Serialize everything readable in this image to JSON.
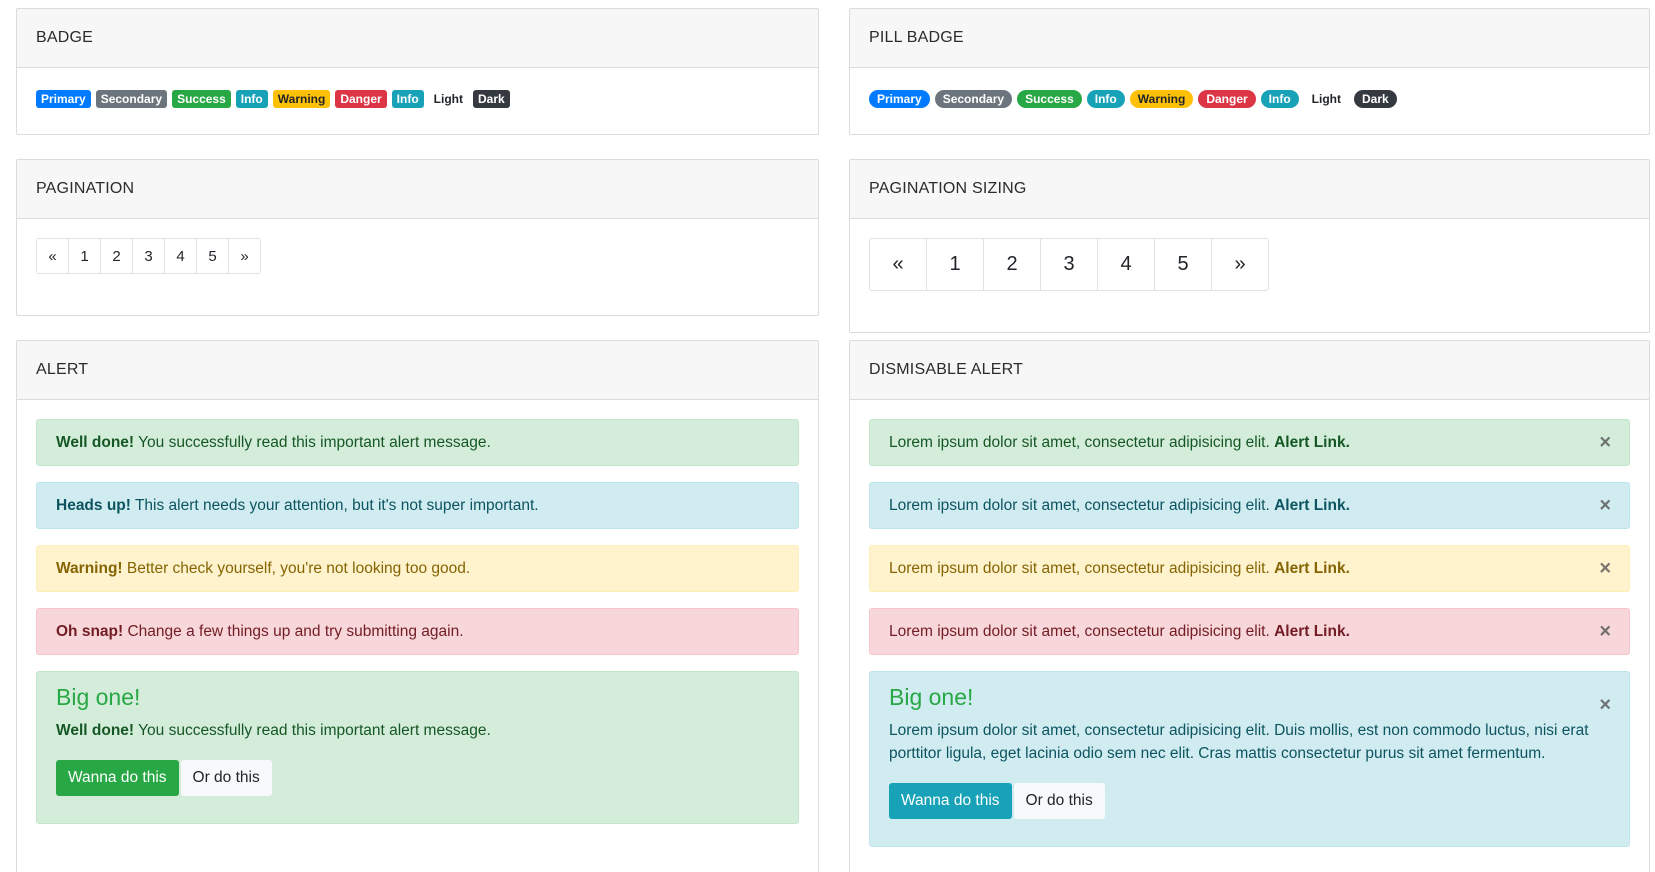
{
  "badge_card": {
    "title": "BADGE",
    "badges": [
      "Primary",
      "Secondary",
      "Success",
      "Info",
      "Warning",
      "Danger",
      "Info",
      "Light",
      "Dark"
    ]
  },
  "pill_card": {
    "title": "PILL BADGE",
    "badges": [
      "Primary",
      "Secondary",
      "Success",
      "Info",
      "Warning",
      "Danger",
      "Info",
      "Light",
      "Dark"
    ]
  },
  "pagination_card": {
    "title": "PAGINATION",
    "pages": [
      "«",
      "1",
      "2",
      "3",
      "4",
      "5",
      "»"
    ]
  },
  "pagination_sizing_card": {
    "title": "PAGINATION SIZING",
    "pages": [
      "«",
      "1",
      "2",
      "3",
      "4",
      "5",
      "»"
    ]
  },
  "alert_card": {
    "title": "ALERT",
    "alerts": [
      {
        "strong": "Well done!",
        "text": " You successfully read this important alert message."
      },
      {
        "strong": "Heads up!",
        "text": " This alert needs your attention, but it's not super important."
      },
      {
        "strong": "Warning!",
        "text": " Better check yourself, you're not looking too good."
      },
      {
        "strong": "Oh snap!",
        "text": " Change a few things up and try submitting again."
      }
    ],
    "big": {
      "title": "Big one!",
      "strong": "Well done!",
      "text": " You successfully read this important alert message.",
      "primary_button": "Wanna do this",
      "secondary_button": "Or do this"
    }
  },
  "dismissable_card": {
    "title": "DISMISABLE ALERT",
    "alerts": [
      {
        "text": "Lorem ipsum dolor sit amet, consectetur adipisicing elit. ",
        "link": "Alert Link."
      },
      {
        "text": "Lorem ipsum dolor sit amet, consectetur adipisicing elit. ",
        "link": "Alert Link."
      },
      {
        "text": "Lorem ipsum dolor sit amet, consectetur adipisicing elit. ",
        "link": "Alert Link."
      },
      {
        "text": "Lorem ipsum dolor sit amet, consectetur adipisicing elit. ",
        "link": "Alert Link."
      }
    ],
    "close_symbol": "×",
    "big": {
      "title": "Big one!",
      "text": "Lorem ipsum dolor sit amet, consectetur adipisicing elit. Duis mollis, est non commodo luctus, nisi erat porttitor ligula, eget lacinia odio sem nec elit. Cras mattis consectetur purus sit amet fermentum.",
      "primary_button": "Wanna do this",
      "secondary_button": "Or do this"
    }
  },
  "colors": {
    "primary": "#007bff",
    "secondary": "#6c757d",
    "success": "#28a745",
    "info": "#17a2b8",
    "warning": "#ffc107",
    "danger": "#dc3545",
    "dark": "#343a40"
  }
}
